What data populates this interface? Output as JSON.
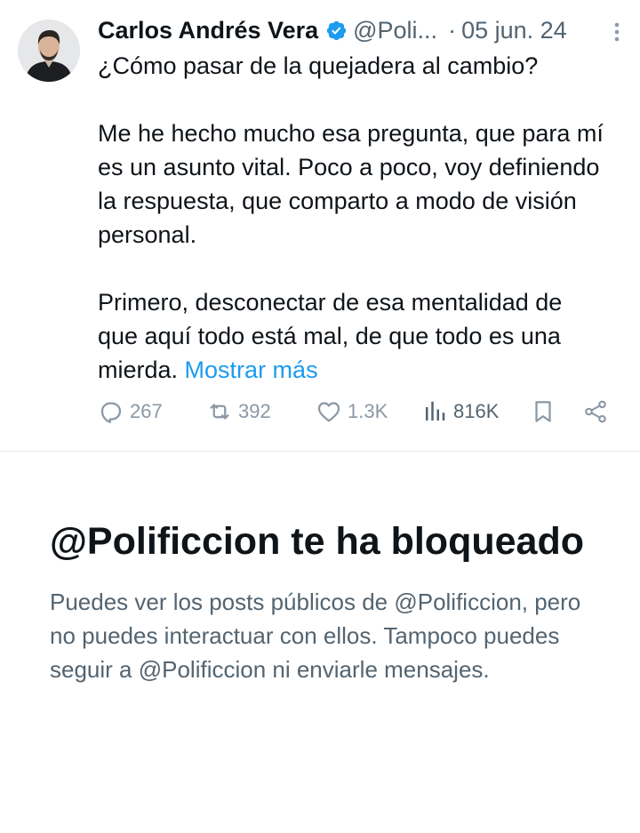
{
  "tweet": {
    "author_name": "Carlos Andrés Vera",
    "handle": "@Poli...",
    "separator": "·",
    "date": "05 jun. 24",
    "text": {
      "p1": "¿Cómo pasar de la quejadera al cambio?",
      "p2": "Me he hecho mucho esa pregunta, que para mí es un asunto vital. Poco a poco, voy definiendo la respuesta, que comparto a modo de visión personal.",
      "p3": "Primero, desconectar de esa mentalidad de que aquí todo está mal, de que todo es una mierda.",
      "show_more": "Mostrar más"
    },
    "stats": {
      "replies": "267",
      "reposts": "392",
      "likes": "1.3K",
      "views": "816K"
    },
    "icons": {
      "verified": "verified-badge-icon",
      "more": "more-vertical-icon",
      "reply": "reply-icon",
      "repost": "repost-icon",
      "like": "heart-icon",
      "views": "views-icon",
      "bookmark": "bookmark-icon",
      "share": "share-icon"
    }
  },
  "blocked_notice": {
    "title": "@Polificcion te ha bloqueado",
    "description": "Puedes ver los posts públicos de @Polificcion, pero no puedes interactuar con ellos. Tampoco puedes seguir a @Polificcion ni enviarle mensajes."
  },
  "colors": {
    "link": "#1d9bf0",
    "verified": "#1d9bf0",
    "secondary_text": "#536471",
    "muted_icon": "#8b98a5"
  }
}
